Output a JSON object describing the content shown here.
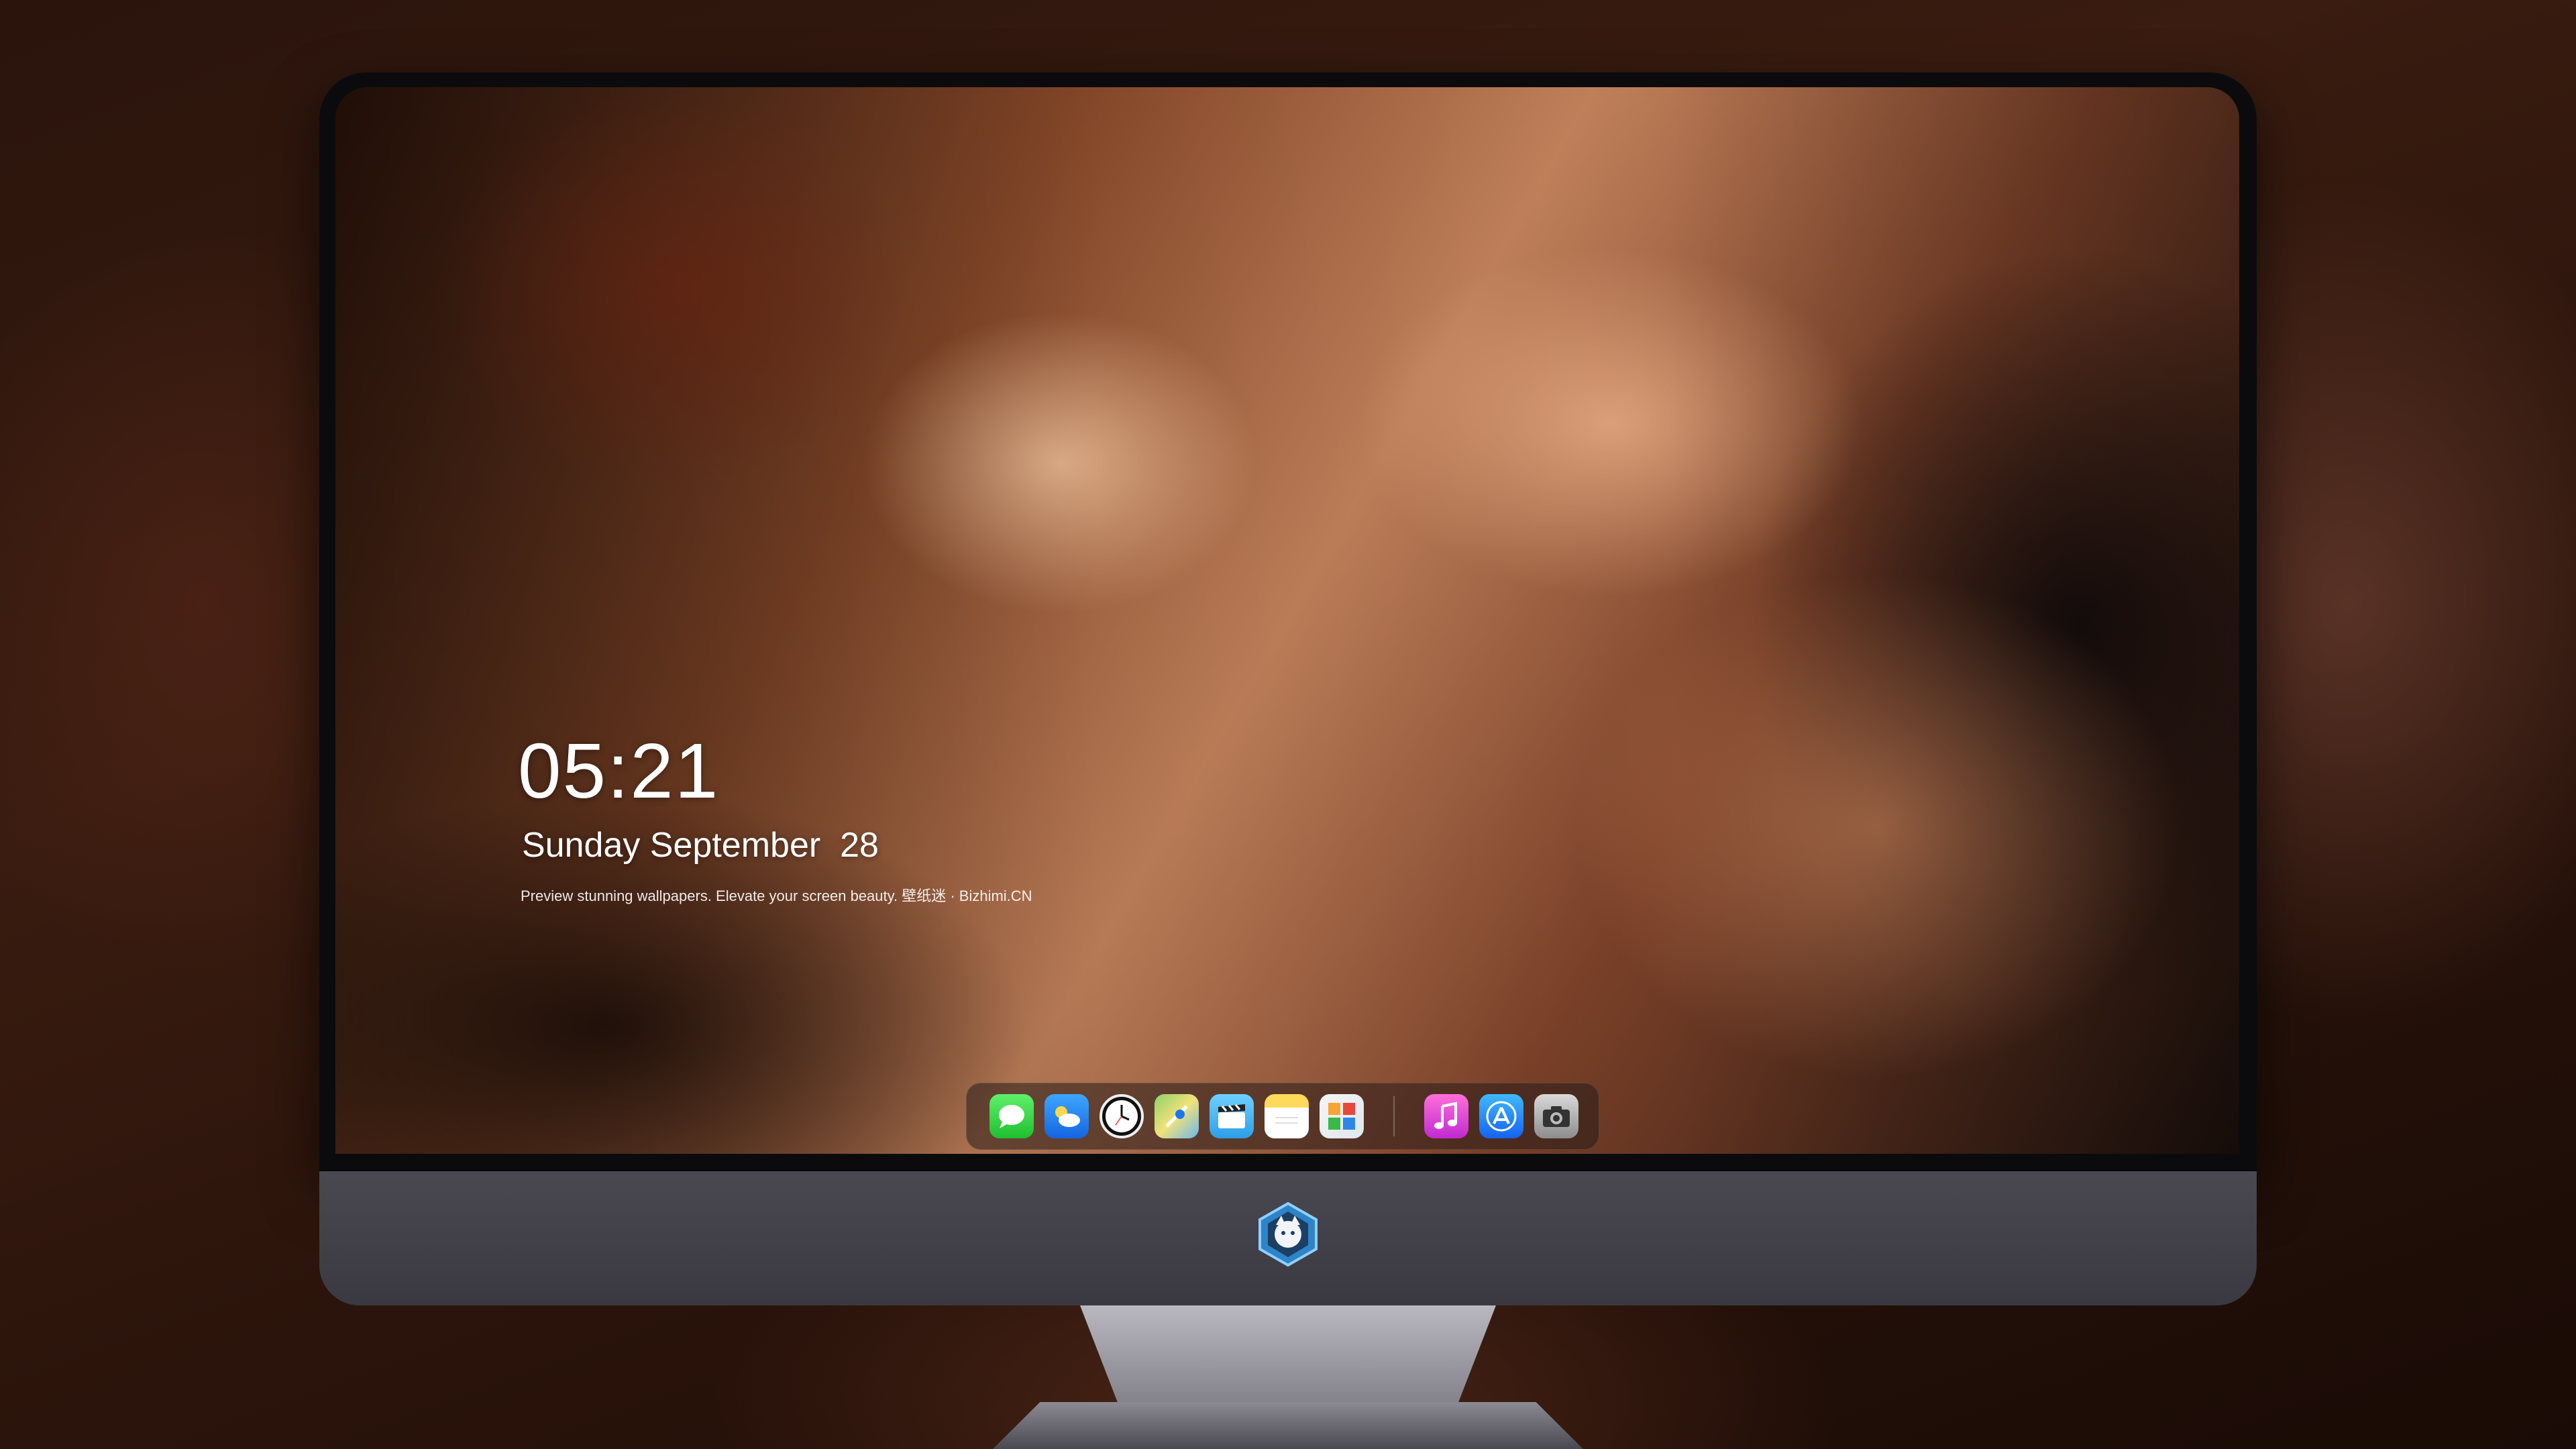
{
  "lock_screen": {
    "time": "05:21",
    "date": "Sunday September  28",
    "caption": "Preview stunning wallpapers. Elevate your screen beauty. 壁纸迷 · Bizhimi.CN"
  },
  "dock": {
    "apps": [
      {
        "name": "Messages",
        "icon": "speech-bubble-icon"
      },
      {
        "name": "Weather",
        "icon": "cloud-sun-icon"
      },
      {
        "name": "Clock",
        "icon": "clock-icon"
      },
      {
        "name": "Maps",
        "icon": "map-icon"
      },
      {
        "name": "Clips",
        "icon": "clapperboard-icon"
      },
      {
        "name": "Notes",
        "icon": "notes-icon"
      },
      {
        "name": "Photos",
        "icon": "photos-icon"
      },
      {
        "name": "Music",
        "icon": "music-note-icon"
      },
      {
        "name": "App Store",
        "icon": "app-store-icon"
      },
      {
        "name": "Camera",
        "icon": "camera-icon"
      }
    ]
  },
  "colors": {
    "messages": "#28c83a",
    "weather": "#1f7ff0",
    "music": "#d23ad8",
    "app_store": "#1d75f2",
    "chin": "#424149"
  }
}
